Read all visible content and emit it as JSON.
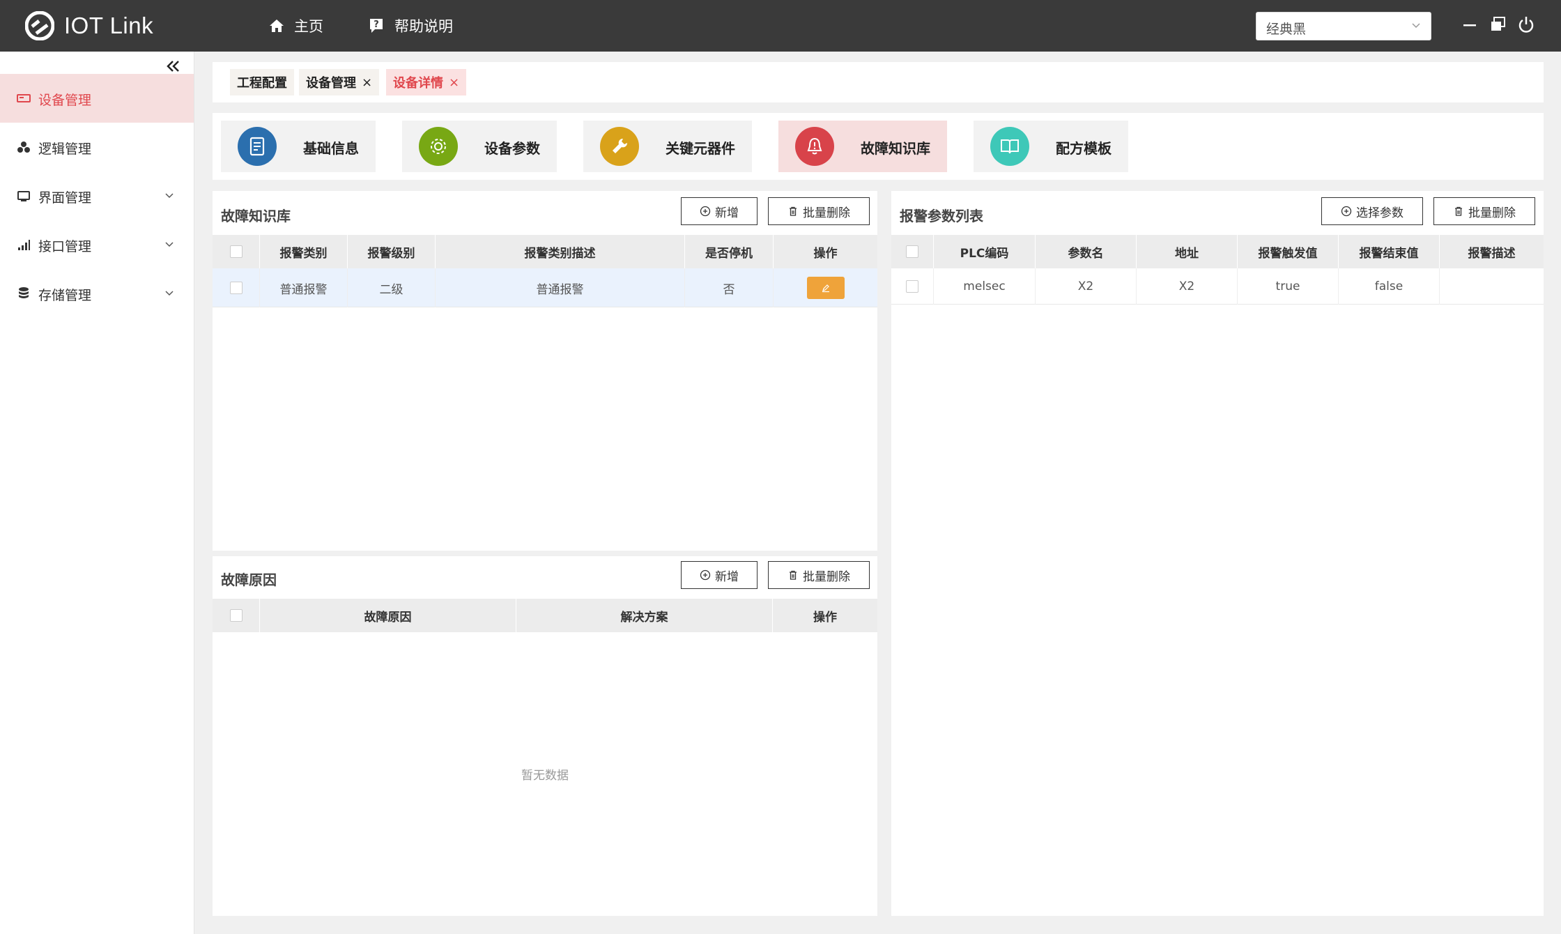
{
  "app": {
    "title": "IOT Link"
  },
  "topnav": {
    "home": "主页",
    "help": "帮助说明"
  },
  "theme": {
    "selected": "经典黑"
  },
  "sidebar": {
    "items": [
      {
        "label": "设备管理",
        "icon": "device-icon",
        "active": true
      },
      {
        "label": "逻辑管理",
        "icon": "logic-icon"
      },
      {
        "label": "界面管理",
        "icon": "monitor-icon"
      },
      {
        "label": "接口管理",
        "icon": "signal-icon"
      },
      {
        "label": "存储管理",
        "icon": "database-icon"
      }
    ]
  },
  "tabs": [
    {
      "label": "工程配置"
    },
    {
      "label": "设备管理",
      "close": "×"
    },
    {
      "label": "设备详情",
      "close": "×",
      "active": true
    }
  ],
  "modules": [
    {
      "label": "基础信息",
      "icon": "document-icon",
      "color": "#2b6fae"
    },
    {
      "label": "设备参数",
      "icon": "gear-icon",
      "color": "#78a814"
    },
    {
      "label": "关键元器件",
      "icon": "wrench-icon",
      "color": "#d9a21a"
    },
    {
      "label": "故障知识库",
      "icon": "alarm-bell-icon",
      "color": "#d8434a",
      "active": true
    },
    {
      "label": "配方模板",
      "icon": "book-icon",
      "color": "#3ec8b8"
    }
  ],
  "fault_kb": {
    "title": "故障知识库",
    "add": "新增",
    "batch_delete": "批量删除",
    "columns": [
      "报警类别",
      "报警级别",
      "报警类别描述",
      "是否停机",
      "操作"
    ],
    "rows": [
      {
        "category": "普通报警",
        "level": "二级",
        "description": "普通报警",
        "stop": "否"
      }
    ]
  },
  "fault_cause": {
    "title": "故障原因",
    "add": "新增",
    "batch_delete": "批量删除",
    "columns": [
      "故障原因",
      "解决方案",
      "操作"
    ],
    "empty": "暂无数据"
  },
  "alarm_params": {
    "title": "报警参数列表",
    "select": "选择参数",
    "batch_delete": "批量删除",
    "columns": [
      "PLC编码",
      "参数名",
      "地址",
      "报警触发值",
      "报警结束值",
      "报警描述"
    ],
    "rows": [
      {
        "plc": "melsec",
        "name": "X2",
        "address": "X2",
        "trigger": "true",
        "end": "false",
        "desc": ""
      }
    ]
  }
}
